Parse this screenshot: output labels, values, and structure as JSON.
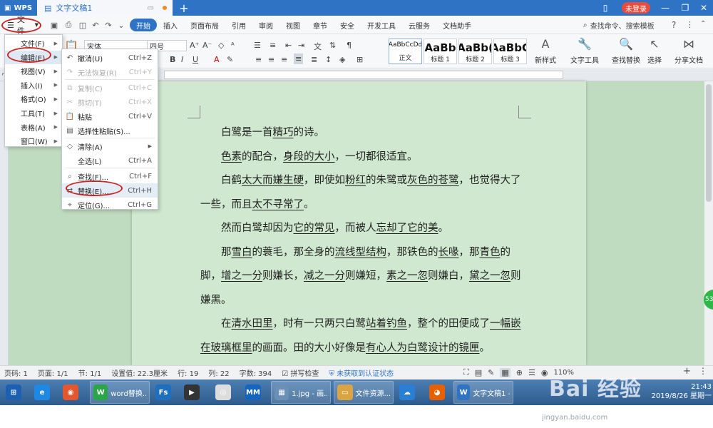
{
  "app": {
    "brand": "WPS",
    "doc_tab_title": "文字文稿1",
    "login_label": "未登录",
    "window_controls": [
      "restore-icon",
      "minimize-icon",
      "maximize-icon",
      "close-icon"
    ]
  },
  "menubar": {
    "file_label": "文件",
    "ribbon_tabs": [
      "开始",
      "插入",
      "页面布局",
      "引用",
      "审阅",
      "视图",
      "章节",
      "安全",
      "开发工具",
      "云服务",
      "文档助手"
    ],
    "active_tab": "开始",
    "command_search": "查找命令、搜索模板",
    "help_label": "?"
  },
  "ribbon": {
    "font_name": "宋体",
    "font_size": "四号",
    "styles": [
      {
        "sample": "AaBbCcDd",
        "label": "正文"
      },
      {
        "sample": "AaBb",
        "label": "标题 1"
      },
      {
        "sample": "AaBb(",
        "label": "标题 2"
      },
      {
        "sample": "AaBbC",
        "label": "标题 3"
      }
    ],
    "tools": [
      {
        "icon": "new-style-icon",
        "label": "新样式"
      },
      {
        "icon": "text-tools-icon",
        "label": "文字工具"
      },
      {
        "icon": "find-replace-icon",
        "label": "查找替换"
      },
      {
        "icon": "select-icon",
        "label": "选择"
      },
      {
        "icon": "share-icon",
        "label": "分享文档"
      }
    ]
  },
  "file_menu": {
    "items": [
      {
        "label": "文件(F)",
        "has_sub": true
      },
      {
        "label": "编辑(E)",
        "has_sub": true
      },
      {
        "label": "视图(V)",
        "has_sub": true
      },
      {
        "label": "插入(I)",
        "has_sub": true
      },
      {
        "label": "格式(O)",
        "has_sub": true
      },
      {
        "label": "工具(T)",
        "has_sub": true
      },
      {
        "label": "表格(A)",
        "has_sub": true
      },
      {
        "label": "窗口(W)",
        "has_sub": true
      }
    ]
  },
  "edit_menu": {
    "items": [
      {
        "icon": "undo-icon",
        "label": "撤消(U)",
        "shortcut": "Ctrl+Z",
        "disabled": false
      },
      {
        "icon": "redo-icon",
        "label": "无法恢复(R)",
        "shortcut": "Ctrl+Y",
        "disabled": true
      },
      {
        "icon": "copy-icon",
        "label": "复制(C)",
        "shortcut": "Ctrl+C",
        "disabled": true
      },
      {
        "icon": "cut-icon",
        "label": "剪切(T)",
        "shortcut": "Ctrl+X",
        "disabled": true
      },
      {
        "icon": "paste-icon",
        "label": "粘贴",
        "shortcut": "Ctrl+V",
        "disabled": false
      },
      {
        "icon": "paste-special-icon",
        "label": "选择性粘贴(S)...",
        "shortcut": "",
        "disabled": false
      },
      {
        "icon": "clear-icon",
        "label": "清除(A)",
        "shortcut": "",
        "disabled": false,
        "has_sub": true
      },
      {
        "icon": "",
        "label": "全选(L)",
        "shortcut": "Ctrl+A",
        "disabled": false
      },
      {
        "icon": "find-icon",
        "label": "查找(F)...",
        "shortcut": "Ctrl+F",
        "disabled": false
      },
      {
        "icon": "replace-icon",
        "label": "替换(E)...",
        "shortcut": "Ctrl+H",
        "disabled": false
      },
      {
        "icon": "goto-icon",
        "label": "定位(G)...",
        "shortcut": "Ctrl+G",
        "disabled": false
      }
    ]
  },
  "document": {
    "paragraphs_html_free": true,
    "p1": [
      "白鹭是一首",
      "精巧",
      "的诗。"
    ],
    "p2": [
      "色素",
      "的配合，",
      "身段的大小",
      "，一切都很适宜。"
    ],
    "p3": [
      "白鹤",
      "太大而嫌生硬",
      "，即使如",
      "粉红",
      "的朱鹭或",
      "灰色的苍鹭",
      "，也觉得大了一些，而且",
      "太不寻常了",
      "。"
    ],
    "p4": [
      "然而白鹭却因为",
      "它的常见",
      "，而被人",
      "忘却了它的美",
      "。"
    ],
    "p5": [
      "那",
      "雪白",
      "的蓑毛，那全身的",
      "流线型结构",
      "，那铁色的",
      "长喙",
      "，那",
      "青色",
      "的脚，",
      "增之一分",
      "则嫌长，",
      "减之一分",
      "则嫌短，",
      "素之一忽",
      "则嫌白，",
      "黛之一忽",
      "则嫌黑。"
    ],
    "p6": [
      "在",
      "清水田里",
      "，时有一只两只白鹭",
      "站着钓鱼",
      "，整个的田便成了",
      "一幅嵌在玻璃框里",
      "的画面。田的大小好像是",
      "有心人为白鹭设计的镜匣",
      "。"
    ]
  },
  "statusbar": {
    "page": "页码: 1",
    "pages": "页面: 1/1",
    "section": "节: 1/1",
    "setting": "设置值: 22.3厘米",
    "row": "行: 19",
    "col": "列: 22",
    "chars": "字数: 394",
    "spell": "拼写检查",
    "auth": "未获取到认证状态",
    "zoom": "110%"
  },
  "taskbar": {
    "items": [
      {
        "icon": "start-icon",
        "label": ""
      },
      {
        "icon": "ie-icon",
        "label": ""
      },
      {
        "icon": "browser-icon",
        "label": ""
      },
      {
        "icon": "word-green-icon",
        "label": "word替换..."
      },
      {
        "icon": "fs-icon",
        "label": ""
      },
      {
        "icon": "media-icon",
        "label": ""
      },
      {
        "icon": "panda-icon",
        "label": ""
      },
      {
        "icon": "mm-icon",
        "label": ""
      },
      {
        "icon": "image-viewer-icon",
        "label": "1.jpg - 画..."
      },
      {
        "icon": "explorer-icon",
        "label": "文件资源..."
      },
      {
        "icon": "cloud-icon",
        "label": ""
      },
      {
        "icon": "firefox-icon",
        "label": ""
      },
      {
        "icon": "wps-writer-icon",
        "label": "文字文稿1 -..."
      }
    ],
    "clock_time": "21:43",
    "clock_date": "2019/8/26 星期一"
  },
  "watermark": {
    "text": "Bai 经验",
    "url": "jingyan.baidu.com"
  },
  "colors": {
    "titlebar": "#2f74c4",
    "login": "#e94c3d",
    "doc_bg": "#bfdcc0",
    "page_bg": "#cfe8cf",
    "annotation": "#c62828"
  }
}
